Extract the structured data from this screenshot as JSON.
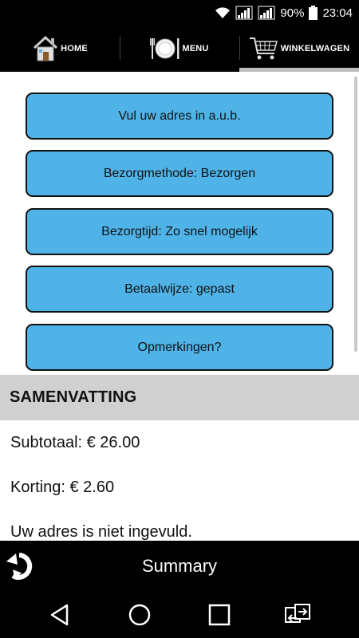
{
  "status_bar": {
    "battery": "90%",
    "time": "23:04",
    "icons": [
      "wifi-icon",
      "signal-icon",
      "roaming-signal-icon",
      "battery-icon"
    ]
  },
  "nav": {
    "tabs": [
      {
        "label": "HOME",
        "icon": "house-icon",
        "active": false
      },
      {
        "label": "MENU",
        "icon": "plate-cutlery-icon",
        "active": false
      },
      {
        "label": "WINKELWAGEN",
        "icon": "shopping-cart-icon",
        "active": true
      }
    ]
  },
  "options": [
    {
      "label": "Vul uw adres in a.u.b."
    },
    {
      "label": "Bezorgmethode: Bezorgen"
    },
    {
      "label": "Bezorgtijd: Zo snel mogelijk"
    },
    {
      "label": "Betaalwijze: gepast"
    },
    {
      "label": "Opmerkingen?"
    }
  ],
  "summary": {
    "header": "SAMENVATTING",
    "lines": [
      "Subtotaal: € 26.00",
      "Korting: € 2.60",
      "Uw adres is niet ingevuld."
    ]
  },
  "bottom_bar": {
    "title": "Summary",
    "back_icon": "back-arrow-icon"
  },
  "system_nav": {
    "icons": [
      "back-triangle-icon",
      "home-circle-icon",
      "recents-square-icon",
      "switch-apps-icon"
    ]
  },
  "colors": {
    "button_fill": "#4fb3e8",
    "header_fill": "#d0d0d0",
    "bar": "#000000"
  }
}
